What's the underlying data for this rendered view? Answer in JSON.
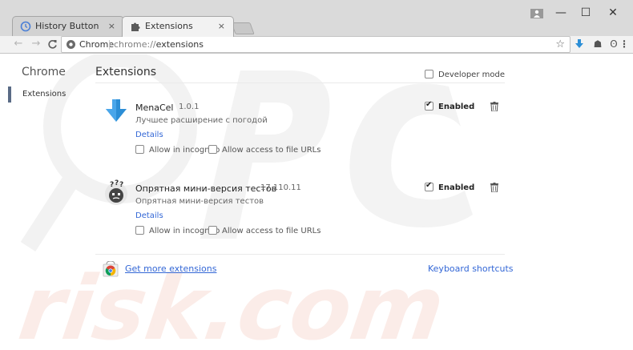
{
  "tabs": [
    {
      "label": "History Button",
      "close": "×"
    },
    {
      "label": "Extensions",
      "close": "×"
    }
  ],
  "window": {
    "minimize": "—",
    "maximize": "☐",
    "close": "✕"
  },
  "toolbar": {
    "back": "←",
    "forward": "→",
    "reload": "C",
    "chip": "Chrome",
    "url_scheme": "chrome://",
    "url_path": "extensions",
    "star": "☆",
    "download_ext": "⬇",
    "shield_ext": "☗",
    "face_ext": "ʘ",
    "menu": "⋮"
  },
  "sidebar": {
    "title": "Chrome",
    "items": [
      {
        "label": "Extensions"
      }
    ]
  },
  "main": {
    "title": "Extensions",
    "developer_mode": {
      "label": "Developer mode",
      "checked": false
    }
  },
  "extensions": [
    {
      "name": "MenaCel",
      "version": "1.0.1",
      "description": "Лучшее расширение с погодой",
      "details_label": "Details",
      "incognito_label": "Allow in incognito",
      "file_urls_label": "Allow access to file URLs",
      "enabled_label": "Enabled",
      "enabled": true,
      "icon": "download-arrow-icon",
      "accent": "#2c8ed6"
    },
    {
      "name": "Опрятная мини-версия тестов",
      "version": "17.110.11",
      "description": "Опрятная мини-версия тестов",
      "details_label": "Details",
      "incognito_label": "Allow in incognito",
      "file_urls_label": "Allow access to file URLs",
      "enabled_label": "Enabled",
      "enabled": true,
      "icon": "confused-face-icon"
    }
  ],
  "footer": {
    "get_more": "Get more extensions",
    "keyboard_shortcuts": "Keyboard shortcuts"
  },
  "colors": {
    "link": "#3367d6",
    "sidebar_indicator": "#5a6b86"
  },
  "watermark": "PC risk.com"
}
